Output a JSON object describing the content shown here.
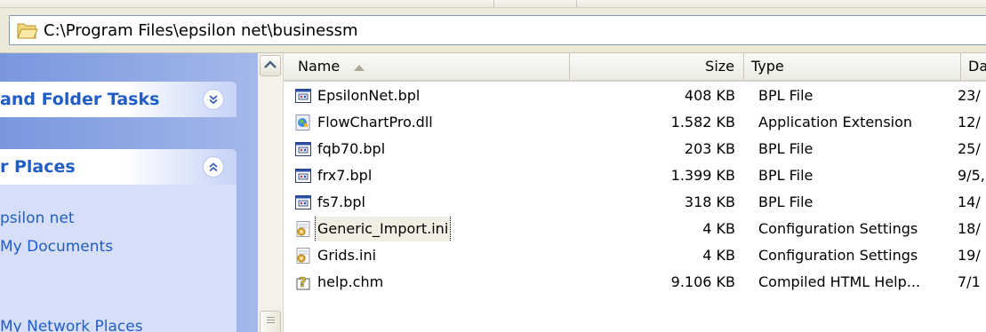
{
  "address": {
    "path": "C:\\Program Files\\epsilon net\\businessm"
  },
  "taskpane": {
    "groups": [
      {
        "title": "and Folder Tasks",
        "collapsed": true
      },
      {
        "title": "r Places",
        "collapsed": false,
        "links": [
          "psilon net",
          "My Documents",
          "My Network Places"
        ]
      }
    ]
  },
  "list": {
    "columns": [
      {
        "label": "Name",
        "sorted": "ascending"
      },
      {
        "label": "Size"
      },
      {
        "label": "Type"
      },
      {
        "label": "Dat"
      }
    ],
    "rows": [
      {
        "icon": "bpl-file-icon",
        "name": "EpsilonNet.bpl",
        "size": "408 KB",
        "type": "BPL File",
        "date": "23/"
      },
      {
        "icon": "dll-file-icon",
        "name": "FlowChartPro.dll",
        "size": "1.582 KB",
        "type": "Application Extension",
        "date": "12/"
      },
      {
        "icon": "bpl-file-icon",
        "name": "fqb70.bpl",
        "size": "203 KB",
        "type": "BPL File",
        "date": "25/"
      },
      {
        "icon": "bpl-file-icon",
        "name": "frx7.bpl",
        "size": "1.399 KB",
        "type": "BPL File",
        "date": "9/5,"
      },
      {
        "icon": "bpl-file-icon",
        "name": "fs7.bpl",
        "size": "318 KB",
        "type": "BPL File",
        "date": "14/"
      },
      {
        "icon": "ini-file-icon",
        "name": "Generic_Import.ini",
        "size": "4 KB",
        "type": "Configuration Settings",
        "date": "18/",
        "selected": true
      },
      {
        "icon": "ini-file-icon",
        "name": "Grids.ini",
        "size": "4 KB",
        "type": "Configuration Settings",
        "date": "19/"
      },
      {
        "icon": "chm-file-icon",
        "name": "help.chm",
        "size": "9.106 KB",
        "type": "Compiled HTML Help...",
        "date": "7/1"
      }
    ]
  },
  "colors": {
    "taskpane_blue": "#7a96df",
    "task_title": "#215dc6",
    "address_border": "#7f9db9"
  }
}
